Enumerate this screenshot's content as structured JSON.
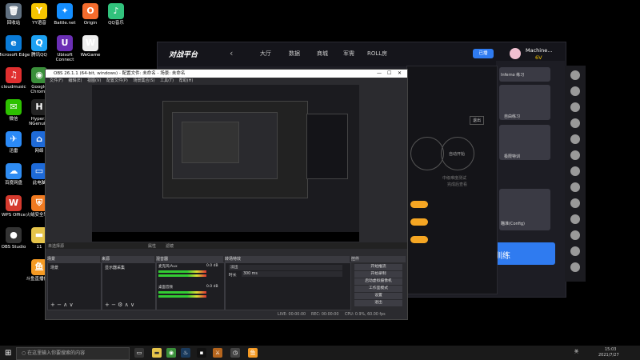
{
  "desktop": {
    "icons": [
      {
        "label": "回收站",
        "glyph": "🗑",
        "color": "#607080"
      },
      {
        "label": "YY语音",
        "glyph": "Y",
        "color": "#f5c400"
      },
      {
        "label": "Battle.net",
        "glyph": "✦",
        "color": "#148eff"
      },
      {
        "label": "Origin",
        "glyph": "O",
        "color": "#f56c2d"
      },
      {
        "label": "QQ音乐",
        "glyph": "♪",
        "color": "#31c27c"
      },
      {
        "label": "Microsoft Edge",
        "glyph": "e",
        "color": "#0a7bd7"
      },
      {
        "label": "腾讯QQ",
        "glyph": "Q",
        "color": "#1da1f2"
      },
      {
        "label": "Ubisoft Connect",
        "glyph": "U",
        "color": "#6b2fb5"
      },
      {
        "label": "WeGame",
        "glyph": "W",
        "color": "#eeeeee"
      },
      {
        "label": "cloudmusic",
        "glyph": "♫",
        "color": "#e02f2f"
      },
      {
        "label": "Google Chrome",
        "glyph": "◉",
        "color": "#3a8f3a"
      },
      {
        "label": "微信",
        "glyph": "✉",
        "color": "#2dc100"
      },
      {
        "label": "HyperX NGenuity",
        "glyph": "H",
        "color": "#222222"
      },
      {
        "label": "迅雷",
        "glyph": "✈",
        "color": "#2b8af7"
      },
      {
        "label": "网络",
        "glyph": "⌂",
        "color": "#1e6ad8"
      },
      {
        "label": "百度网盘",
        "glyph": "☁",
        "color": "#2f8cf2"
      },
      {
        "label": "此电脑",
        "glyph": "▭",
        "color": "#1e6ad8"
      },
      {
        "label": "WPS Office",
        "glyph": "W",
        "color": "#d53a2e"
      },
      {
        "label": "火绒安全软件",
        "glyph": "⛨",
        "color": "#f07a20"
      },
      {
        "label": "OBS Studio",
        "glyph": "●",
        "color": "#333333"
      },
      {
        "label": "11",
        "glyph": "▬",
        "color": "#e6c44a"
      },
      {
        "label": "斗鱼直播伴侣",
        "glyph": "鱼",
        "color": "#f59a23"
      }
    ]
  },
  "game_platform": {
    "logo": "对战平台",
    "back": "‹",
    "nav": [
      "大厅",
      "数据",
      "商城",
      "军需",
      "ROLL房"
    ],
    "btn": "已播",
    "username": "Machine...",
    "level": "6V",
    "panel_labels": [
      "Inferno 练习",
      "自由练习",
      "极限特训",
      "瞄准(Config)"
    ],
    "training": "训练",
    "mode_label": "自动开始",
    "exit": "退出"
  },
  "obs": {
    "title": "OBS 26.1.1 (64-bit, windows) - 配置文件: 未命名 - 场景: 未命名",
    "menu": [
      "文件(F)",
      "编辑(E)",
      "视图(V)",
      "配置文件(P)",
      "场景集合(S)",
      "工具(T)",
      "帮助(H)"
    ],
    "preview_bar": [
      "属性",
      "滤镜"
    ],
    "no_source": "未选择源",
    "docks": {
      "scenes": "场景",
      "sources": "来源",
      "mixer": "混音器",
      "transitions": "转场特效",
      "controls": "控件"
    },
    "scene_item": "场景",
    "source_item": "显示器采集",
    "mixer_rows": [
      {
        "name": "麦克风/Aux",
        "db": "0.0 dB"
      },
      {
        "name": "桌面音频",
        "db": "0.0 dB"
      }
    ],
    "transition_type": "淡出",
    "duration_label": "时长",
    "duration_value": "300 ms",
    "control_buttons": [
      "开始推流",
      "开始录制",
      "启动虚拟摄像机",
      "工作室模式",
      "设置",
      "退出"
    ],
    "status": {
      "live": "LIVE: 00:00:00",
      "rec": "REC: 00:00:00",
      "cpu": "CPU: 0.9%, 60.00 fps"
    }
  },
  "tool_window": {
    "note": "中级难度测试",
    "note2": "完成后查看"
  },
  "taskbar": {
    "search_placeholder": "在这里输入你要搜索的内容",
    "time": "15:03",
    "date": "2021/7/27",
    "lang": "英"
  }
}
